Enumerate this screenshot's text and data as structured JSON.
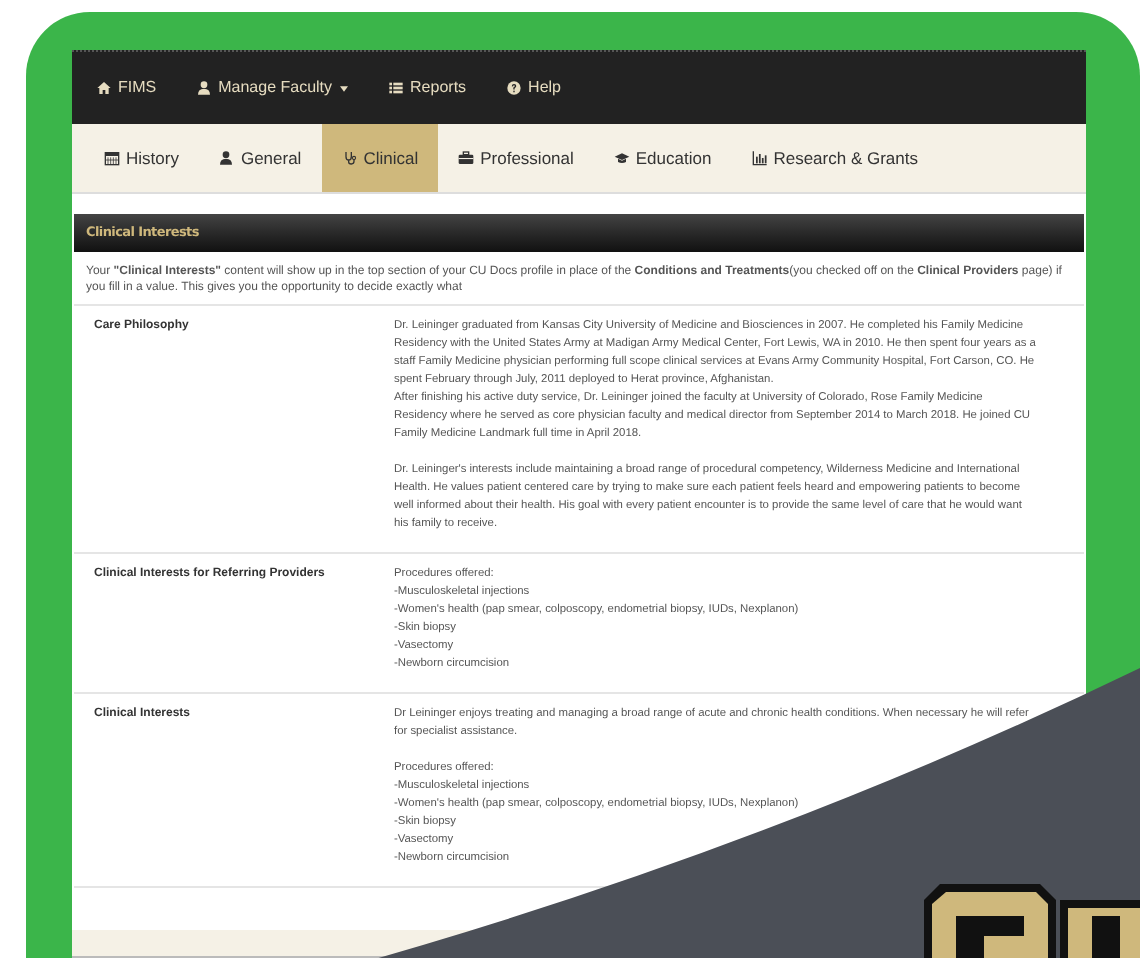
{
  "nav": [
    {
      "kind": "home",
      "label": "FIMS",
      "dropdown": false
    },
    {
      "kind": "user",
      "label": "Manage Faculty",
      "dropdown": true
    },
    {
      "kind": "list",
      "label": "Reports",
      "dropdown": false
    },
    {
      "kind": "question",
      "label": "Help",
      "dropdown": false
    }
  ],
  "tabs": [
    {
      "kind": "calendar",
      "label": "History",
      "selected": false
    },
    {
      "kind": "user",
      "label": "General",
      "selected": false
    },
    {
      "kind": "stethoscope",
      "label": "Clinical",
      "selected": true
    },
    {
      "kind": "briefcase",
      "label": "Professional",
      "selected": false
    },
    {
      "kind": "cap",
      "label": "Education",
      "selected": false
    },
    {
      "kind": "bars",
      "label": "Research & Grants",
      "selected": false
    }
  ],
  "section": {
    "title": "Clinical Interests",
    "intro": "Your **\"Clinical Interests\"** content will show up in the top section of your CU Docs profile in place of the **Conditions and Treatments**(you checked off on the **Clinical Providers** page) if you fill in a value. This gives you the opportunity to decide exactly what"
  },
  "rows": [
    {
      "label": "Care Philosophy",
      "paragraphs": [
        "Dr. Leininger graduated from Kansas City University of Medicine and Biosciences in 2007. He completed his Family Medicine Residency with the United States Army at Madigan Army Medical Center, Fort Lewis, WA in 2010. He then spent four years as a staff Family Medicine physician performing full scope clinical services at Evans Army Community Hospital, Fort Carson, CO. He spent February through July, 2011 deployed to Herat province, Afghanistan.\nAfter finishing his active duty service, Dr. Leininger joined the faculty at University of Colorado, Rose Family Medicine Residency where he served as core physician faculty and medical director from September 2014 to March 2018. He joined CU Family Medicine Landmark full time in April 2018.",
        "Dr. Leininger's interests include maintaining a broad range of procedural competency, Wilderness Medicine and International Health. He values patient centered care by trying to make sure each patient feels heard and empowering patients to become well informed about their health. His goal with every patient encounter is to provide the same level of care that he would want his family to receive."
      ]
    },
    {
      "label": "Clinical Interests for Referring Providers",
      "paragraphs": [
        "Procedures offered:\n-Musculoskeletal injections\n-Women's health (pap smear, colposcopy, endometrial biopsy, IUDs, Nexplanon)\n-Skin biopsy\n-Vasectomy\n-Newborn circumcision"
      ]
    },
    {
      "label": "Clinical Interests",
      "paragraphs": [
        "Dr Leininger enjoys treating and managing a broad range of acute and chronic health conditions. When necessary he will refer for specialist assistance.",
        "Procedures offered:\n-Musculoskeletal injections\n-Women's health (pap smear, colposcopy, endometrial biopsy, IUDs, Nexplanon)\n-Skin biopsy\n-Vasectomy\n-Newborn circumcision"
      ]
    }
  ]
}
